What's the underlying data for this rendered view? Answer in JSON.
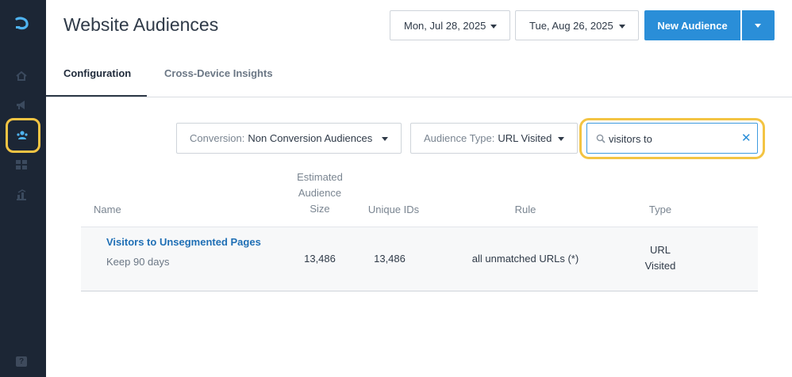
{
  "header": {
    "title": "Website Audiences",
    "start_date": "Mon, Jul 28, 2025",
    "end_date": "Tue, Aug 26, 2025",
    "new_button_label": "New Audience"
  },
  "tabs": [
    {
      "label": "Configuration",
      "active": true
    },
    {
      "label": "Cross-Device Insights",
      "active": false
    }
  ],
  "filters": {
    "conversion": {
      "label": "Conversion:",
      "value": "Non Conversion Audiences"
    },
    "audience_type": {
      "label": "Audience Type:",
      "value": "URL Visited"
    },
    "search": {
      "value": "visitors to"
    }
  },
  "table": {
    "columns": {
      "name": "Name",
      "size_line1": "Estimated",
      "size_line2": "Audience",
      "size_line3": "Size",
      "unique": "Unique IDs",
      "rule": "Rule",
      "type": "Type"
    },
    "rows": [
      {
        "name": "Visitors to Unsegmented Pages",
        "retention": "Keep 90 days",
        "size": "13,486",
        "unique_ids": "13,486",
        "rule": "all unmatched URLs (*)",
        "type_line1": "URL",
        "type_line2": "Visited"
      }
    ]
  },
  "sidebar": {
    "help_label": "?",
    "items": [
      {
        "icon": "home-icon"
      },
      {
        "icon": "megaphone-icon"
      },
      {
        "icon": "audiences-icon",
        "active": true
      },
      {
        "icon": "dashboard-grid-icon"
      },
      {
        "icon": "reports-chart-icon"
      }
    ]
  },
  "colors": {
    "sidebar_bg": "#1c2635",
    "accent": "#2a8ed8",
    "highlight": "#f3c443",
    "link": "#1f6fb5"
  }
}
